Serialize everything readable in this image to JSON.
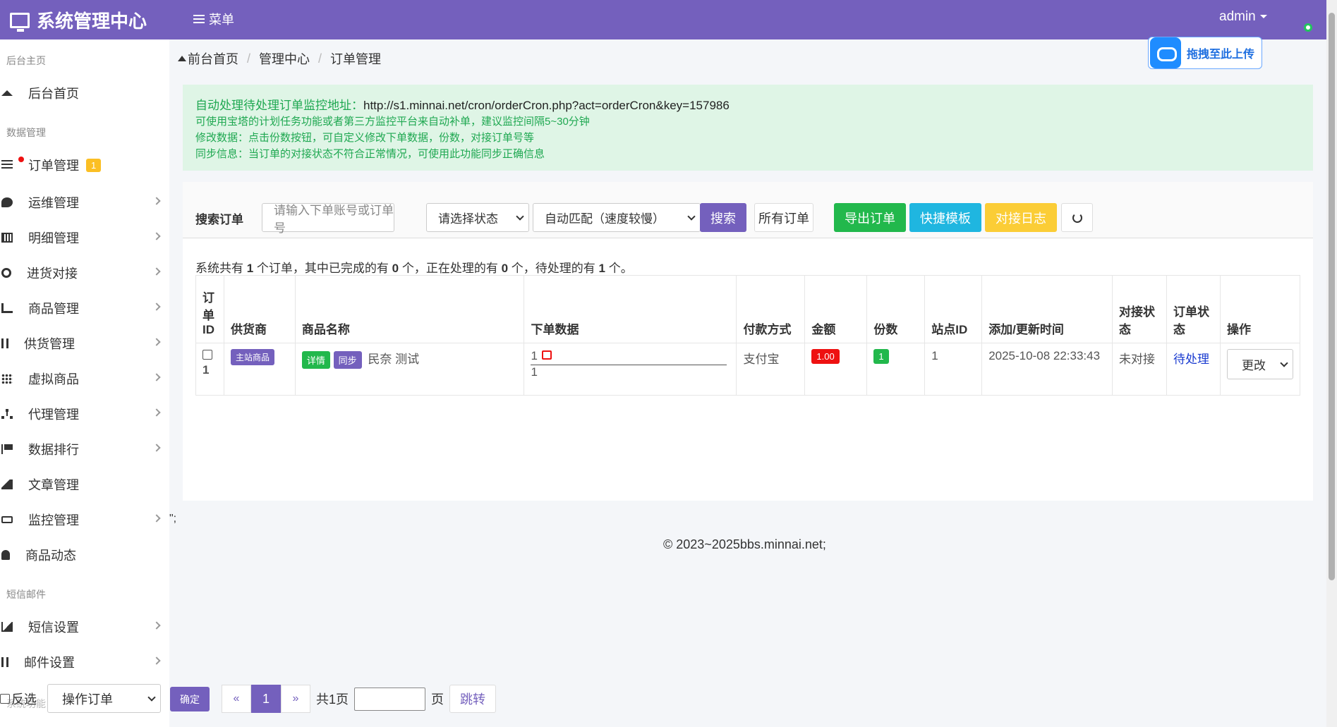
{
  "topbar": {
    "brand": "系统管理中心",
    "menu_label": "菜单",
    "user": "admin"
  },
  "sidebar": {
    "section_home": "后台主页",
    "home": "后台首页",
    "section_data": "数据管理",
    "items": [
      {
        "label": "订单管理",
        "badge": "1"
      },
      {
        "label": "运维管理"
      },
      {
        "label": "明细管理"
      },
      {
        "label": "进货对接"
      },
      {
        "label": "商品管理"
      },
      {
        "label": "供货管理"
      },
      {
        "label": "虚拟商品"
      },
      {
        "label": "代理管理"
      },
      {
        "label": "数据排行"
      },
      {
        "label": "文章管理"
      },
      {
        "label": "监控管理"
      },
      {
        "label": "商品动态"
      }
    ],
    "section_sms": "短信邮件",
    "sms_items": [
      {
        "label": "短信设置"
      },
      {
        "label": "邮件设置"
      }
    ],
    "faded_section": "系统功能"
  },
  "breadcrumb": {
    "home": "前台首页",
    "mid": "管理中心",
    "current": "订单管理"
  },
  "upload_label": "拖拽至此上传",
  "alert": {
    "line1_prefix": "自动处理待处理订单监控地址：",
    "line1_url": "http://s1.minnai.net/cron/orderCron.php?act=orderCron&key=157986",
    "line2": "可使用宝塔的计划任务功能或者第三方监控平台来自动补单，建议监控间隔5~30分钟",
    "line3": "修改数据：点击份数按钮，可自定义修改下单数据，份数，对接订单号等",
    "line4": "同步信息：当订单的对接状态不符合正常情况，可使用此功能同步正确信息"
  },
  "search": {
    "label": "搜索订单",
    "placeholder": "请输入下单账号或订单号",
    "status_select": "请选择状态",
    "match_select": "自动匹配（速度较慢）",
    "search_btn": "搜索",
    "all_btn": "所有订单",
    "export_btn": "导出订单",
    "template_btn": "快捷模板",
    "log_btn": "对接日志"
  },
  "summary": {
    "p1": "系统共有 ",
    "total": "1",
    "p2": " 个订单，其中已完成的有 ",
    "done": "0",
    "p3": " 个，正在处理的有 ",
    "processing": "0",
    "p4": " 个，待处理的有 ",
    "pending": "1",
    "p5": " 个。"
  },
  "table": {
    "headers": [
      "订单ID",
      "供货商",
      "商品名称",
      "下单数据",
      "付款方式",
      "金额",
      "份数",
      "站点ID",
      "添加/更新时间",
      "对接状态",
      "订单状态",
      "操作"
    ],
    "row": {
      "id": "1",
      "supplier_tag": "主站商品",
      "detail_tag": "详情",
      "sync_tag": "同步",
      "product": "民奈 测试",
      "order_data_1": "1",
      "order_data_2": "1",
      "payment": "支付宝",
      "amount": "1.00",
      "qty": "1",
      "site_id": "1",
      "time": "2025-10-08 22:33:43",
      "dock_status": "未对接",
      "order_status": "待处理",
      "op": "更改"
    }
  },
  "quote": "\";",
  "footer": "© 2023~2025bbs.minnai.net;",
  "bottom": {
    "invert": "反选",
    "op_select": "操作订单",
    "confirm": "确定",
    "prev": "«",
    "page": "1",
    "next": "»",
    "total_pages": "共1页",
    "page_unit": "页",
    "jump": "跳转"
  }
}
